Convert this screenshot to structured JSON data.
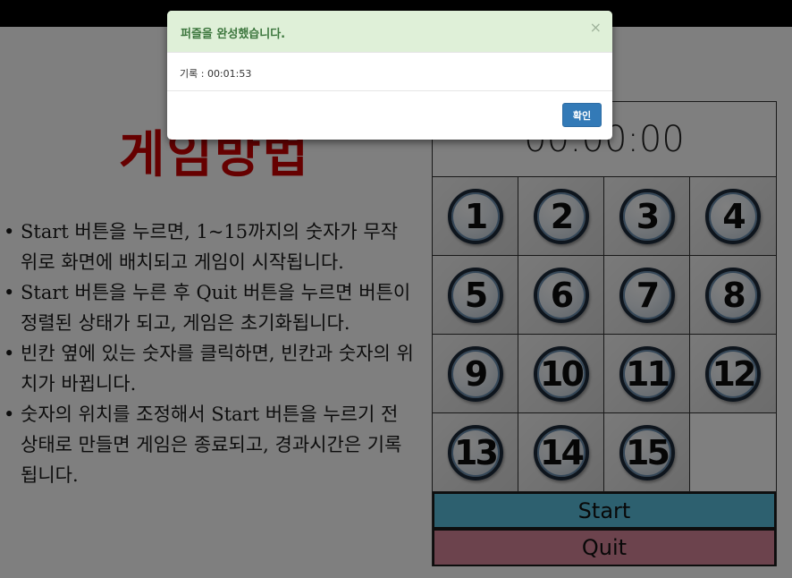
{
  "page": {
    "howto_title": "게임방법",
    "rules": [
      "Start 버튼을 누르면, 1~15까지의 숫자가 무작위로 화면에 배치되고 게임이 시작됩니다.",
      "Start 버튼을 누른 후 Quit 버튼을 누르면 버튼이 정렬된 상태가 되고, 게임은 초기화됩니다.",
      "빈칸 옆에 있는 숫자를 클릭하면, 빈칸과 숫자의 위치가 바뀝니다.",
      "숫자의 위치를 조정해서 Start 버튼을 누르기 전 상태로 만들면 게임은 종료되고, 경과시간은 기록됩니다."
    ]
  },
  "game": {
    "timer": "00:00:00",
    "tiles": [
      "1",
      "2",
      "3",
      "4",
      "5",
      "6",
      "7",
      "8",
      "9",
      "10",
      "11",
      "12",
      "13",
      "14",
      "15",
      ""
    ],
    "start_label": "Start",
    "quit_label": "Quit"
  },
  "modal": {
    "title": "퍼즐을 완성했습니다.",
    "close_glyph": "×",
    "record": "기록 : 00:01:53",
    "ok_label": "확인"
  },
  "colors": {
    "title_red": "#cc0000",
    "start_bg": "#5bc0de",
    "quit_bg": "#d9869a",
    "modal_header_bg": "#dff0d8",
    "modal_title": "#3c763d",
    "ok_button": "#337ab7"
  }
}
